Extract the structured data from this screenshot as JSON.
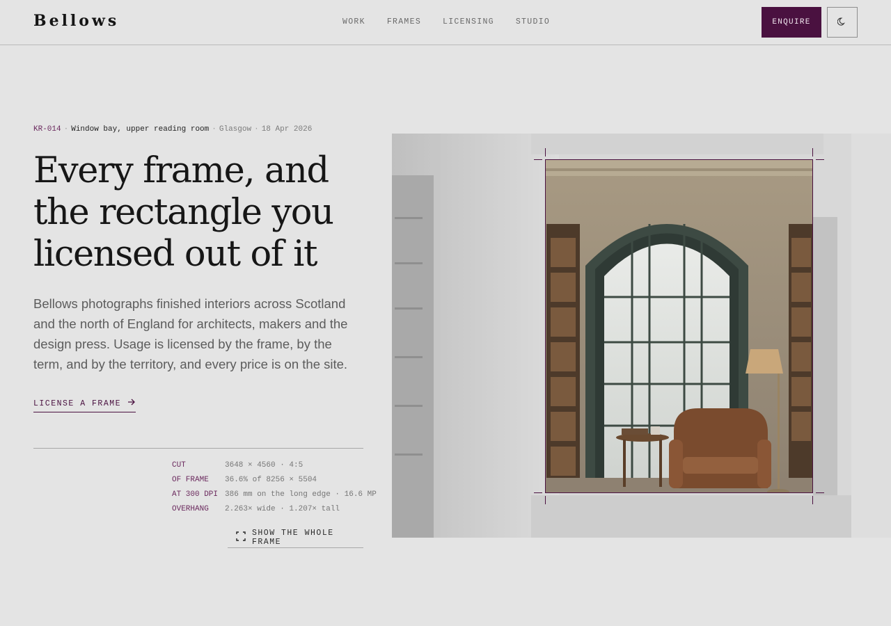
{
  "brand": "Bellows",
  "nav": [
    "WORK",
    "FRAMES",
    "LICENSING",
    "STUDIO"
  ],
  "header": {
    "enquire_label": "ENQUIRE",
    "theme_icon": "moon-icon"
  },
  "meta": {
    "code": "KR-014",
    "title": "Window bay, upper reading room",
    "place": "Glasgow",
    "date": "18 Apr 2026",
    "separator": "·"
  },
  "headline": "Every frame, and the rectangle you licensed out of it",
  "lede": "Bellows photographs finished interiors across Scotland and the north of England for architects, makers and the design press. Usage is licensed by the frame, by the term, and by the territory, and every price is on the site.",
  "cta": {
    "label": "LICENSE A FRAME",
    "icon": "arrow-right-icon"
  },
  "spec": [
    {
      "key": "CUT",
      "value": "3648 × 4560 · 4:5"
    },
    {
      "key": "OF FRAME",
      "value": "36.6% of 8256 × 5504"
    },
    {
      "key": "AT 300 DPI",
      "value": "386 mm on the long edge · 16.6 MP"
    },
    {
      "key": "OVERHANG",
      "value": "2.263× wide · 1.207× tall"
    }
  ],
  "show_frame": {
    "label": "SHOW THE WHOLE FRAME",
    "icon": "expand-icon"
  },
  "colors": {
    "accent": "#4a1140",
    "background": "#e4e4e4",
    "ink": "#161616",
    "muted": "#5c5c5c"
  }
}
